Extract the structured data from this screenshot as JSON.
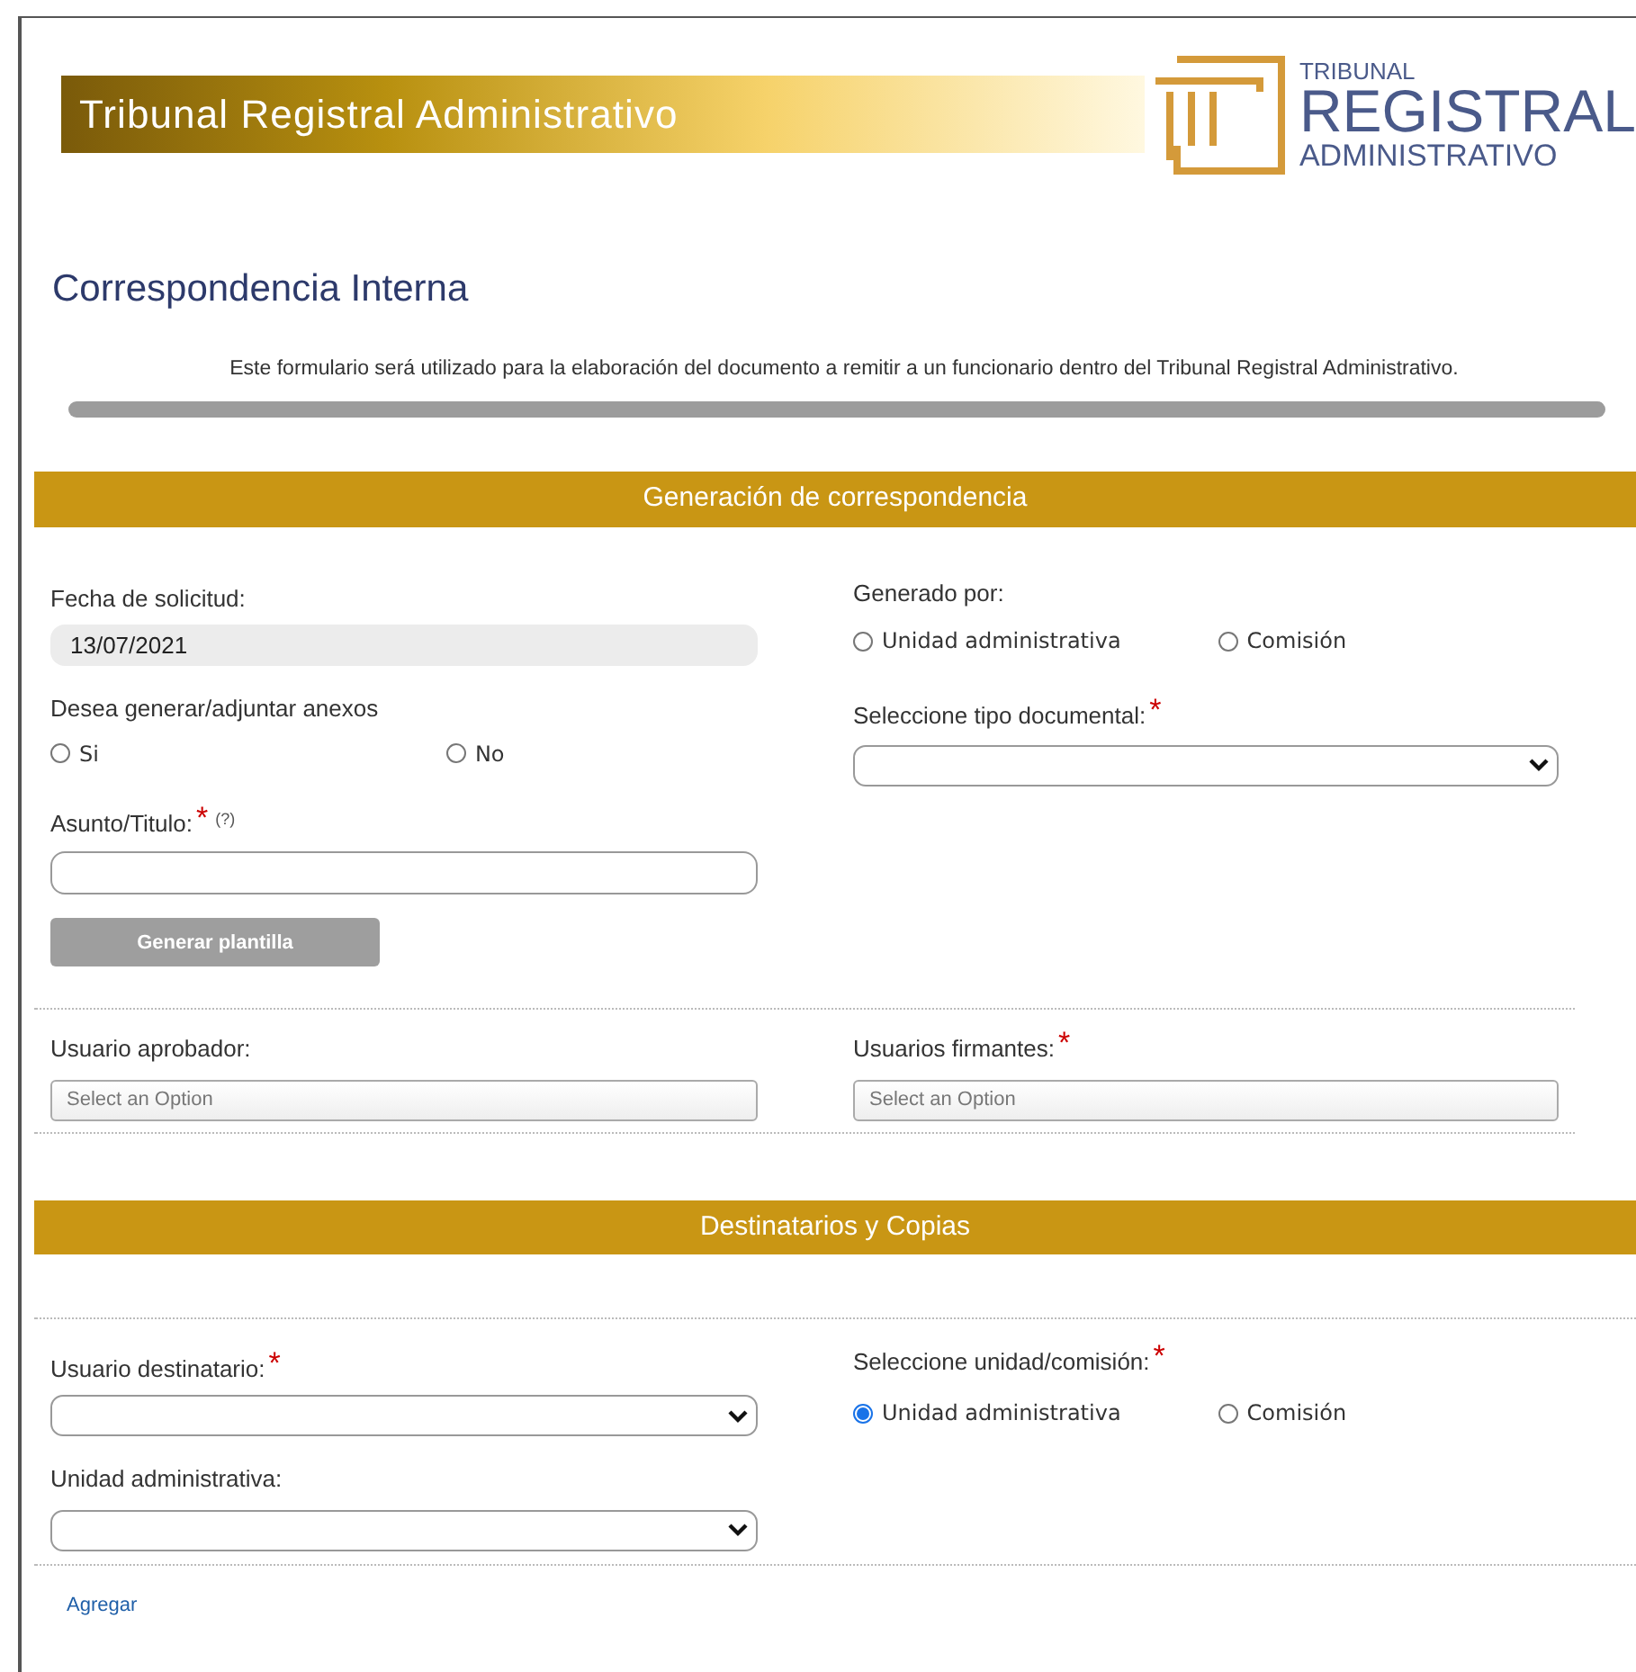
{
  "banner": {
    "title": "Tribunal Registral Administrativo"
  },
  "logo": {
    "line_1": "TRIBUNAL",
    "line_2": "REGISTRAL",
    "line_3": "ADMINISTRATIVO"
  },
  "page": {
    "title": "Correspondencia Interna",
    "description": "Este formulario será utilizado para la elaboración del documento a remitir a un funcionario dentro del Tribunal Registral Administrativo."
  },
  "section_1": {
    "title": "Generación de correspondencia",
    "fecha": {
      "label": "Fecha de solicitud:",
      "value": "13/07/2021"
    },
    "generado_por": {
      "label": "Generado por:",
      "options": [
        {
          "label": "Unidad administrativa",
          "selected": false
        },
        {
          "label": "Comisión",
          "selected": false
        }
      ]
    },
    "anexos": {
      "label": "Desea generar/adjuntar anexos",
      "options": [
        {
          "label": "Si",
          "selected": false
        },
        {
          "label": "No",
          "selected": false
        }
      ]
    },
    "tipo_documental": {
      "label": "Seleccione tipo documental:",
      "required_mark": "*"
    },
    "asunto": {
      "label": "Asunto/Titulo:",
      "required_mark": "*",
      "help": "(?)"
    },
    "button": "Generar plantilla",
    "aprobador": {
      "label": "Usuario aprobador:",
      "placeholder": "Select an Option"
    },
    "firmantes": {
      "label": "Usuarios firmantes:",
      "required_mark": "*",
      "placeholder": "Select an Option"
    }
  },
  "section_2": {
    "title": "Destinatarios y Copias",
    "destinatario": {
      "label": "Usuario destinatario:",
      "required_mark": "*"
    },
    "unidad_comision": {
      "label": "Seleccione unidad/comisión:",
      "required_mark": "*",
      "options": [
        {
          "label": "Unidad administrativa",
          "selected": true
        },
        {
          "label": "Comisión",
          "selected": false
        }
      ]
    },
    "unidad": {
      "label": "Unidad administrativa:"
    },
    "link": "Agregar"
  }
}
